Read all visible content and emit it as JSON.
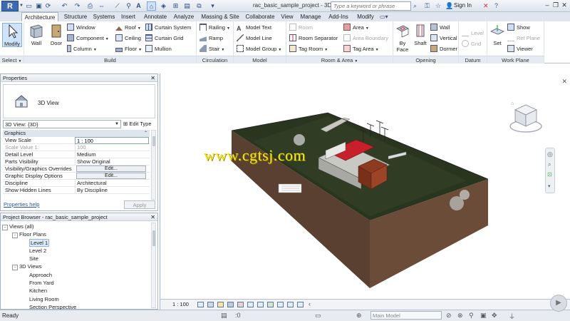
{
  "titlebar": {
    "app_logo": "R",
    "document_title": "rac_basic_sample_project - 3D ...",
    "search_placeholder": "Type a keyword or phrase",
    "sign_in": "Sign In"
  },
  "tabs": [
    "Architecture",
    "Structure",
    "Systems",
    "Insert",
    "Annotate",
    "Analyze",
    "Massing & Site",
    "Collaborate",
    "View",
    "Manage",
    "Add-Ins",
    "Modify"
  ],
  "active_tab": "Architecture",
  "ribbon": {
    "select": {
      "modify": "Modify",
      "label": "Select"
    },
    "build": {
      "label": "Build",
      "wall": "Wall",
      "door": "Door",
      "window": "Window",
      "component": "Component",
      "column": "Column",
      "roof": "Roof",
      "ceiling": "Ceiling",
      "floor": "Floor",
      "curtain_system": "Curtain System",
      "curtain_grid": "Curtain Grid",
      "mullion": "Mullion"
    },
    "circulation": {
      "label": "Circulation",
      "railing": "Railing",
      "ramp": "Ramp",
      "stair": "Stair"
    },
    "model": {
      "label": "Model",
      "model_text": "Model Text",
      "model_line": "Model Line",
      "model_group": "Model Group"
    },
    "room_area": {
      "label": "Room & Area",
      "room": "Room",
      "room_separator": "Room Separator",
      "tag_room": "Tag Room",
      "area": "Area",
      "area_boundary": "Area Boundary",
      "tag_area": "Tag Area"
    },
    "opening": {
      "label": "Opening",
      "by_face": "By Face",
      "shaft": "Shaft",
      "wall": "Wall",
      "vertical": "Vertical",
      "dormer": "Dormer"
    },
    "datum": {
      "label": "Datum",
      "level": "Level",
      "grid": "Grid"
    },
    "work_plane": {
      "label": "Work Plane",
      "set": "Set",
      "show": "Show",
      "ref_plane": "Ref Plane",
      "viewer": "Viewer"
    }
  },
  "properties": {
    "title": "Properties",
    "type_name": "3D View",
    "view_selector": "3D View: {3D}",
    "edit_type": "Edit Type",
    "section": "Graphics",
    "rows": [
      {
        "key": "View Scale",
        "value": "1 : 100"
      },
      {
        "key": "Scale Value    1:",
        "value": "100"
      },
      {
        "key": "Detail Level",
        "value": "Medium"
      },
      {
        "key": "Parts Visibility",
        "value": "Show Original"
      },
      {
        "key": "Visibility/Graphics Overrides",
        "value": "Edit..."
      },
      {
        "key": "Graphic Display Options",
        "value": "Edit..."
      },
      {
        "key": "Discipline",
        "value": "Architectural"
      },
      {
        "key": "Show Hidden Lines",
        "value": "By Discipline"
      }
    ],
    "help": "Properties help",
    "apply": "Apply"
  },
  "browser": {
    "title": "Project Browser - rac_basic_sample_project",
    "items": [
      {
        "label": "Views (all)",
        "level": 0,
        "toggle": "-"
      },
      {
        "label": "Floor Plans",
        "level": 1,
        "toggle": "-"
      },
      {
        "label": "Level 1",
        "level": 2,
        "toggle": ""
      },
      {
        "label": "Level 2",
        "level": 2,
        "toggle": ""
      },
      {
        "label": "Site",
        "level": 2,
        "toggle": ""
      },
      {
        "label": "3D Views",
        "level": 1,
        "toggle": "-"
      },
      {
        "label": "Approach",
        "level": 2,
        "toggle": ""
      },
      {
        "label": "From Yard",
        "level": 2,
        "toggle": ""
      },
      {
        "label": "Kitchen",
        "level": 2,
        "toggle": ""
      },
      {
        "label": "Living Room",
        "level": 2,
        "toggle": ""
      },
      {
        "label": "Section Perspective",
        "level": 2,
        "toggle": ""
      }
    ],
    "selected": "Level 1"
  },
  "viewport": {
    "watermark": "www.cgtsj.com",
    "scale": "1 : 100"
  },
  "status": {
    "text": "Ready",
    "workset": "Main Model",
    "zero": ":0"
  },
  "colors": {
    "accent": "#3c6bb3",
    "roof": "#c8202a",
    "terrain_top": "#2a3520",
    "terrain_side": "#5a4030"
  }
}
